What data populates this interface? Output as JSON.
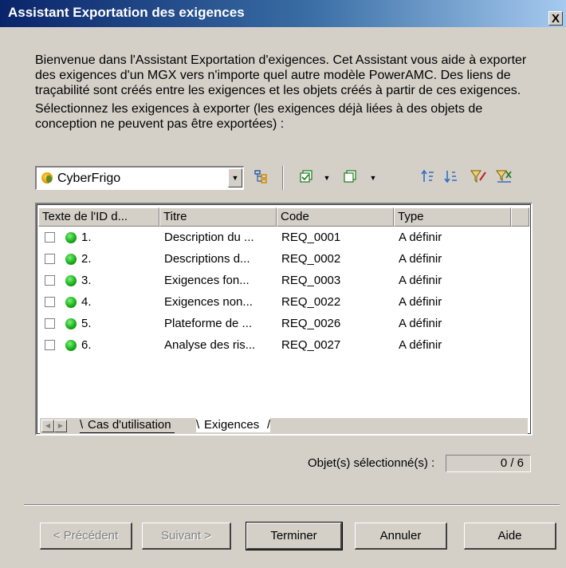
{
  "dialog": {
    "title": "Assistant Exportation des exigences",
    "close_glyph": "X"
  },
  "intro": {
    "welcome": "Bienvenue dans l'Assistant Exportation d'exigences. Cet Assistant vous aide à exporter des exigences d'un MGX vers n'importe quel autre modèle PowerAMC. Des liens de traçabilité sont créés entre les exigences et les objets créés à partir de ces exigences.",
    "instruction": "Sélectionnez les exigences à exporter (les exigences déjà liées à des objets de conception ne peuvent pas être exportées) :"
  },
  "toolbar": {
    "model_selected": "CyberFrigo",
    "icons": [
      "package-icon",
      "hierarchy-icon",
      "check-all-icon",
      "uncheck-all-icon",
      "sort-up-icon",
      "sort-down-icon",
      "filter-icon",
      "clear-filter-icon"
    ]
  },
  "list": {
    "columns": [
      "Texte de l'ID d...",
      "Titre",
      "Code",
      "Type"
    ],
    "rows": [
      {
        "id": "1.",
        "title": "Description du ...",
        "code": "REQ_0001",
        "type": "A définir"
      },
      {
        "id": "2.",
        "title": "Descriptions d...",
        "code": "REQ_0002",
        "type": "A définir"
      },
      {
        "id": "3.",
        "title": "Exigences fon...",
        "code": "REQ_0003",
        "type": "A définir"
      },
      {
        "id": "4.",
        "title": "Exigences non...",
        "code": "REQ_0022",
        "type": "A définir"
      },
      {
        "id": "5.",
        "title": "Plateforme de ...",
        "code": "REQ_0026",
        "type": "A définir"
      },
      {
        "id": "6.",
        "title": "Analyse des ris...",
        "code": "REQ_0027",
        "type": "A définir"
      }
    ],
    "status_color": "#19b019"
  },
  "tabs": [
    {
      "label": "Cas d'utilisation",
      "active": false
    },
    {
      "label": "Exigences",
      "active": true
    }
  ],
  "selection": {
    "label": "Objet(s) sélectionné(s) :",
    "count": "0 / 6"
  },
  "buttons": {
    "previous": "< Précédent",
    "next": "Suivant >",
    "finish": "Terminer",
    "cancel": "Annuler",
    "help": "Aide"
  }
}
